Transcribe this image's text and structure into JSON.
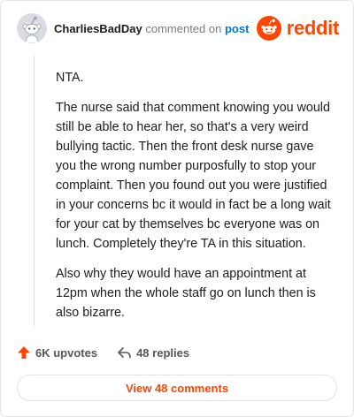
{
  "comment": {
    "author": "CharliesBadDay",
    "action_text": "commented on",
    "post_link_text": "post",
    "brand": "reddit",
    "paragraphs": [
      "NTA.",
      "The nurse said that comment knowing you would still be able to hear her, so that's a very weird bullying tactic. Then the front desk nurse gave you the wrong number purposfully to stop your complaint. Then you found out you were justified in your concerns bc it would in fact be a long wait for your cat by themselves bc everyone was on lunch. Completely they're TA in this situation.",
      "Also why they would have an appointment at 12pm when the whole staff go on lunch then is also bizarre."
    ]
  },
  "stats": {
    "upvotes": "6K upvotes",
    "replies": "48 replies"
  },
  "view_comments_label": "View 48 comments",
  "colors": {
    "brand": "#ff4500",
    "link": "#0079d3"
  },
  "icons": {
    "avatar": "snoo-avatar-icon",
    "brand": "reddit-snoo-icon",
    "upvote": "upvote-arrow-icon",
    "reply": "reply-arrow-icon"
  }
}
